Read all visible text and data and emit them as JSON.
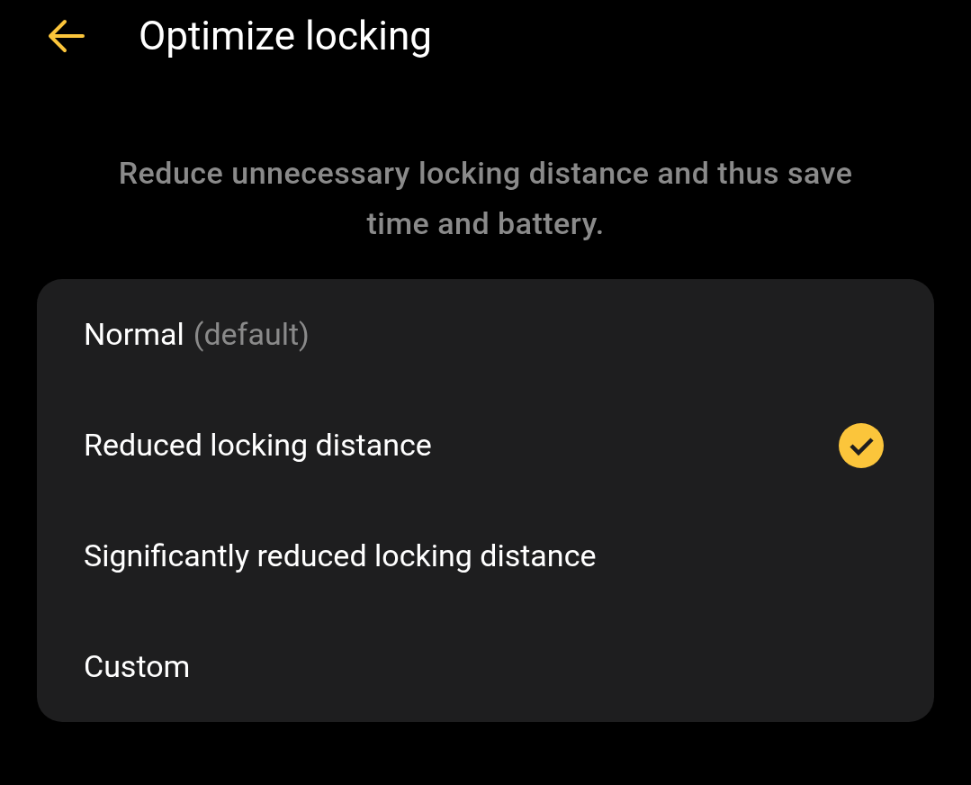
{
  "header": {
    "title": "Optimize locking"
  },
  "description": "Reduce unnecessary locking distance and thus save time and battery.",
  "options": [
    {
      "label": "Normal",
      "note": "(default)",
      "selected": false
    },
    {
      "label": "Reduced locking distance",
      "selected": true
    },
    {
      "label": "Significantly reduced locking distance",
      "selected": false
    },
    {
      "label": "Custom",
      "selected": false
    }
  ]
}
